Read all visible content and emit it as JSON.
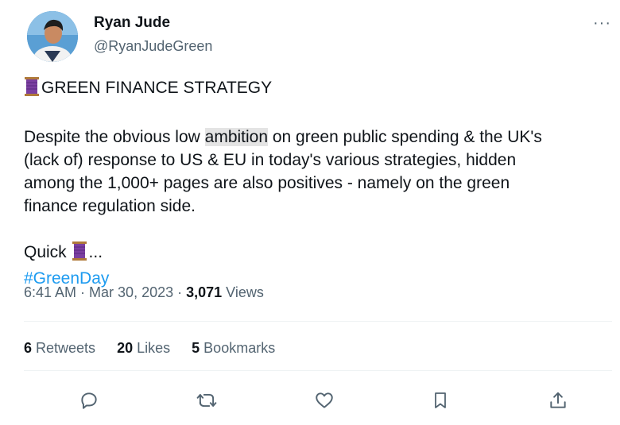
{
  "author": {
    "name": "Ryan Jude",
    "handle": "@RyanJudeGreen",
    "more_label": "···"
  },
  "tweet": {
    "line1": "GREEN FINANCE STRATEGY",
    "para_a1": "Despite the obvious low ",
    "para_highlight": "ambition",
    "para_a2": " on green public spending & the UK's",
    "para_b": "(lack of) response to US & EU in today's various strategies, hidden",
    "para_c": "among the 1,000+ pages are also positives - namely on the green",
    "para_d": "finance regulation side.",
    "quick": "Quick",
    "ellipsis": "...",
    "hashtag": "#GreenDay",
    "emoji_icon": "thread-spool-icon"
  },
  "meta": {
    "time": "6:41 AM",
    "dot": " · ",
    "date": "Mar 30, 2023",
    "views_count": "3,071",
    "views_label": " Views"
  },
  "stats": {
    "retweets_count": "6",
    "retweets_label": " Retweets",
    "likes_count": "20",
    "likes_label": " Likes",
    "bookmarks_count": "5",
    "bookmarks_label": " Bookmarks"
  },
  "actions": [
    "reply-icon",
    "retweet-icon",
    "like-icon",
    "bookmark-icon",
    "share-icon"
  ],
  "colors": {
    "link": "#1d9bf0",
    "secondary": "#536471",
    "spool": "#7b3fa0"
  }
}
